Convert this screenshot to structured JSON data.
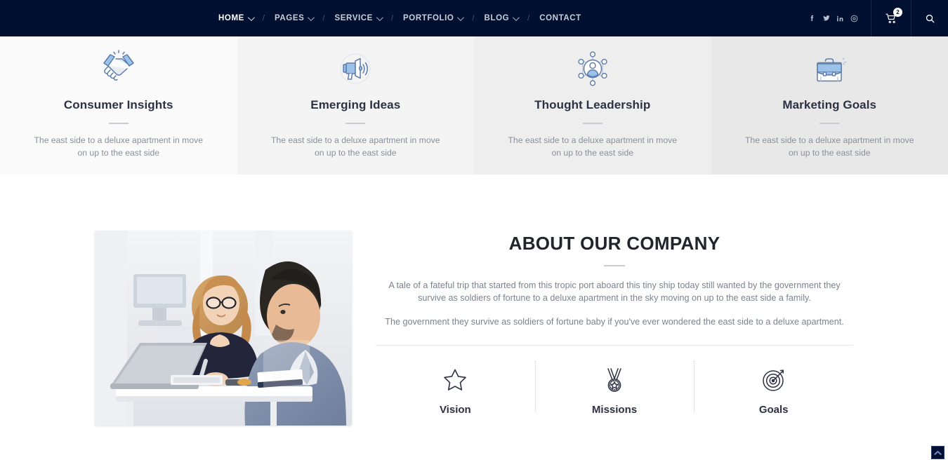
{
  "header": {
    "nav_items": [
      {
        "label": "HOME",
        "has_caret": true,
        "active": true
      },
      {
        "label": "PAGES",
        "has_caret": true,
        "active": false
      },
      {
        "label": "SERVICE",
        "has_caret": true,
        "active": false
      },
      {
        "label": "PORTFOLIO",
        "has_caret": true,
        "active": false
      },
      {
        "label": "BLOG",
        "has_caret": true,
        "active": false
      },
      {
        "label": "CONTACT",
        "has_caret": false,
        "active": false
      }
    ],
    "separator": "/",
    "social": [
      {
        "name": "facebook-icon"
      },
      {
        "name": "twitter-icon"
      },
      {
        "name": "linkedin-icon"
      },
      {
        "name": "pinterest-icon"
      }
    ],
    "cart": {
      "icon": "shopping-cart-icon",
      "badge_count": "2"
    },
    "search": {
      "icon": "search-icon"
    },
    "background_color": "#011031"
  },
  "features": [
    {
      "icon": "handshake-icon",
      "title": "Consumer Insights",
      "description": "The east side to a deluxe apartment in move on up to the east side",
      "background_color": "#fafafa"
    },
    {
      "icon": "megaphone-icon",
      "title": "Emerging Ideas",
      "description": "The east side to a deluxe apartment in move on up to the east side",
      "background_color": "#f4f4f5"
    },
    {
      "icon": "network-person-icon",
      "title": "Thought Leadership",
      "description": "The east side to a deluxe apartment in move on up to the east side",
      "background_color": "#eeeeef"
    },
    {
      "icon": "briefcase-icon",
      "title": "Marketing Goals",
      "description": "The east side to a deluxe apartment in move on up to the east side",
      "background_color": "#e8e8e9"
    }
  ],
  "about": {
    "photo_alt": "businesswoman and businessman working at a desk with a laptop in a bright office",
    "title": "ABOUT OUR COMPANY",
    "paragraph_1": "A tale of a fateful trip that started from this tropic port aboard this tiny ship today still wanted by the government they survive as soldiers of fortune to a deluxe apartment in the sky moving on up to the east side a family.",
    "paragraph_2": "The government they survive as soldiers of fortune baby if you've ever wondered the east side to a deluxe apartment.",
    "pillars": [
      {
        "icon": "star-icon",
        "label": "Vision"
      },
      {
        "icon": "medal-icon",
        "label": "Missions"
      },
      {
        "icon": "target-icon",
        "label": "Goals"
      }
    ]
  },
  "scroll_top": {
    "icon": "chevron-up-icon",
    "background_color": "#011031"
  },
  "theme": {
    "navy": "#011031",
    "icon_blue": "#9cc2ea",
    "icon_outline": "#5b7ba8",
    "heading": "#2d3142",
    "body_text": "#8a8f99"
  }
}
